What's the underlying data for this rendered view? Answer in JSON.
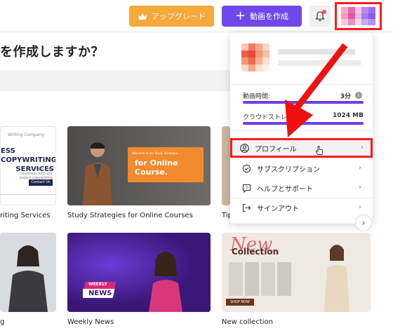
{
  "header": {
    "upgrade_label": "アップグレード",
    "create_label": "動画を作成"
  },
  "main": {
    "heading": "を作成しますか？",
    "cards_row1": [
      {
        "caption": "riting Services",
        "thumb_company": "Writing Company",
        "thumb_title_a": "ESS COPYWRITING",
        "thumb_title_b": "SERVICES",
        "thumb_desc": "Transform your business with our expert copywriting services.",
        "thumb_btn": "Contact Us"
      },
      {
        "caption": "Study Strategies for Online Courses",
        "thumb_small": "Welcome to our Study Strategies",
        "thumb_big": "for Online Course."
      },
      {
        "caption": "Tip"
      }
    ],
    "cards_row2": [
      {
        "caption": "g"
      },
      {
        "caption": "Weekly News",
        "thumb_badge_a": "WEEKLY",
        "thumb_badge_b": "NEWS"
      },
      {
        "caption": "New collection",
        "thumb_new": "New",
        "thumb_collection": "Collection",
        "thumb_shop": "SHOP NOW"
      }
    ]
  },
  "dropdown": {
    "video_time_label": "動画時間:",
    "video_time_value": "3分",
    "video_time_fraction": 1.0,
    "storage_label": "クラウドストレー",
    "storage_value": "1024 MB",
    "storage_fraction": 1.0,
    "items": [
      {
        "label": "プロフィール"
      },
      {
        "label": "サブスクリプション"
      },
      {
        "label": "ヘルプとサポート"
      },
      {
        "label": "サインアウト"
      }
    ]
  },
  "colors": {
    "accent": "#7048e8",
    "upgrade": "#f5a83b",
    "highlight": "#ff1a1a"
  },
  "icons": {
    "upgrade": "crown-icon",
    "create": "plus-icon",
    "bell": "bell-icon",
    "profile": "user-circle-icon",
    "subscription": "badge-check-icon",
    "help": "help-bubble-icon",
    "signout": "sign-out-icon"
  }
}
